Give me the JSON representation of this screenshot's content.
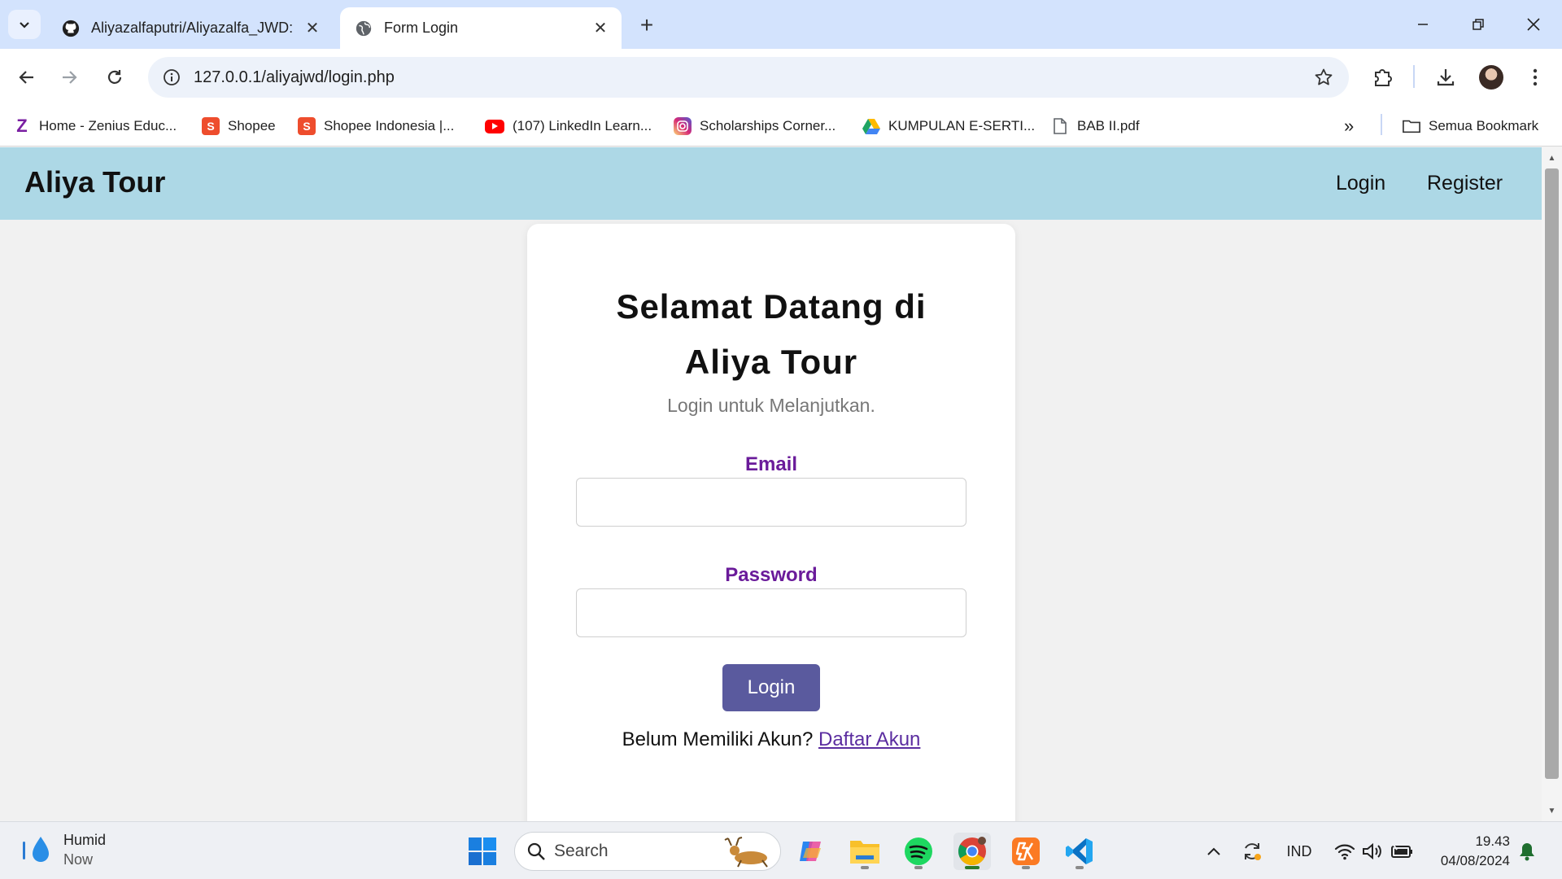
{
  "browser": {
    "tabs": [
      {
        "title": "Aliyazalfaputri/Aliyazalfa_JWD:",
        "favicon": "github-icon",
        "active": false
      },
      {
        "title": "Form Login",
        "favicon": "globe-icon",
        "active": true
      }
    ],
    "url": "127.0.0.1/aliyajwd/login.php",
    "bookmarks": [
      {
        "label": "Home - Zenius Educ...",
        "icon": "zenius-icon",
        "color": "#7a1fa2"
      },
      {
        "label": "Shopee",
        "icon": "shopee-icon",
        "color": "#ee4d2d"
      },
      {
        "label": "Shopee Indonesia |...",
        "icon": "shopee-icon",
        "color": "#ee4d2d"
      },
      {
        "label": "(107) LinkedIn Learn...",
        "icon": "youtube-icon",
        "color": "#ff0000"
      },
      {
        "label": "Scholarships Corner...",
        "icon": "instagram-icon",
        "color": "#d62976"
      },
      {
        "label": "KUMPULAN E-SERTI...",
        "icon": "google-drive-icon",
        "color": "#1fa463"
      },
      {
        "label": "BAB II.pdf",
        "icon": "document-icon",
        "color": "#5f6368"
      }
    ],
    "all_bookmarks": "Semua Bookmark"
  },
  "page": {
    "brand": "Aliya Tour",
    "nav_login": "Login",
    "nav_register": "Register",
    "title_line1": "Selamat Datang di",
    "title_line2": "Aliya Tour",
    "subtitle": "Login untuk Melanjutkan.",
    "email_label": "Email",
    "email_value": "",
    "password_label": "Password",
    "password_value": "",
    "login_button": "Login",
    "no_account_text": "Belum Memiliki Akun?",
    "register_link": "Daftar Akun",
    "navbar_color": "#add8e6",
    "label_color": "#6a1b9a",
    "button_color": "#5a5a9e"
  },
  "taskbar": {
    "weather_title": "Humid",
    "weather_sub": "Now",
    "search_placeholder": "Search",
    "language": "IND",
    "time": "19.43",
    "date": "04/08/2024"
  }
}
